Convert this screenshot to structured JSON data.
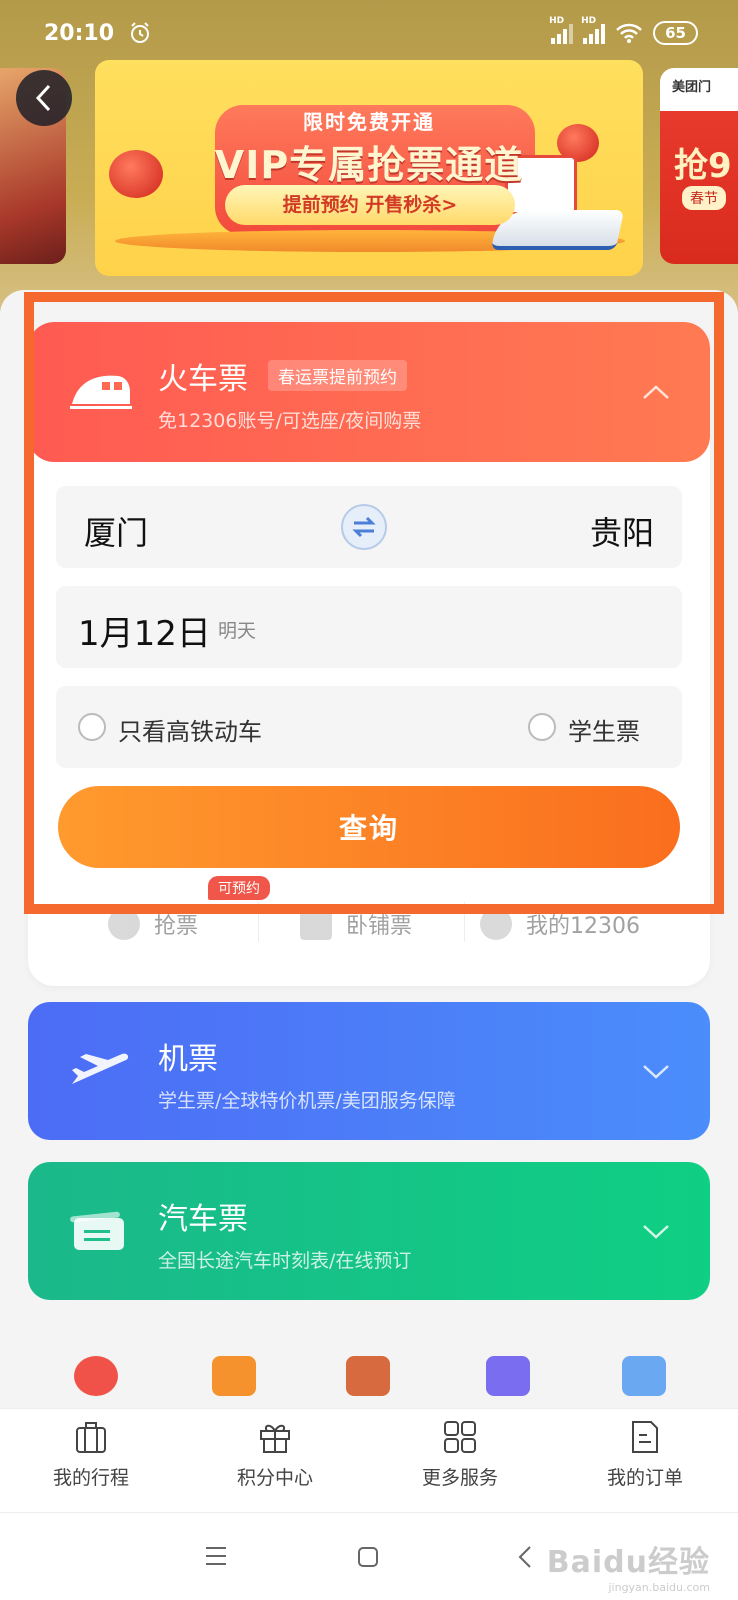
{
  "status_bar": {
    "time": "20:10",
    "battery": "65",
    "network_badge": "HD"
  },
  "banner": {
    "top_label": "限时免费开通",
    "title": "VIP专属抢票通道",
    "subtitle": "提前预约  开售秒杀>",
    "right_brand": "美团门",
    "right_big": "抢9",
    "right_small": "春节"
  },
  "train": {
    "title": "火车票",
    "badge": "春运票提前预约",
    "subtitle": "免12306账号/可选座/夜间购票",
    "from_station": "厦门",
    "to_station": "贵阳",
    "date": "1月12日",
    "date_relative": "明天",
    "option_high_speed": "只看高铁动车",
    "option_student": "学生票",
    "query_label": "查询",
    "quick_links": [
      "抢票",
      "卧铺票",
      "我的12306"
    ],
    "quick_tag": "可预约"
  },
  "flight": {
    "title": "机票",
    "subtitle": "学生票/全球特价机票/美团服务保障"
  },
  "bus": {
    "title": "汽车票",
    "subtitle": "全国长途汽车时刻表/在线预订"
  },
  "tabs": [
    {
      "label": "我的行程",
      "icon": "suitcase-icon"
    },
    {
      "label": "积分中心",
      "icon": "gift-icon"
    },
    {
      "label": "更多服务",
      "icon": "grid-icon"
    },
    {
      "label": "我的订单",
      "icon": "document-icon"
    }
  ],
  "watermark": {
    "text": "Baidu经验",
    "small": "jingyan.baidu.com"
  },
  "colors": {
    "train_header": "#ff5a52",
    "query_button": "#fa6e1e",
    "flight_card": "#4c6cf5",
    "bus_card": "#0fcf84",
    "highlight_frame": "#f5682e"
  }
}
